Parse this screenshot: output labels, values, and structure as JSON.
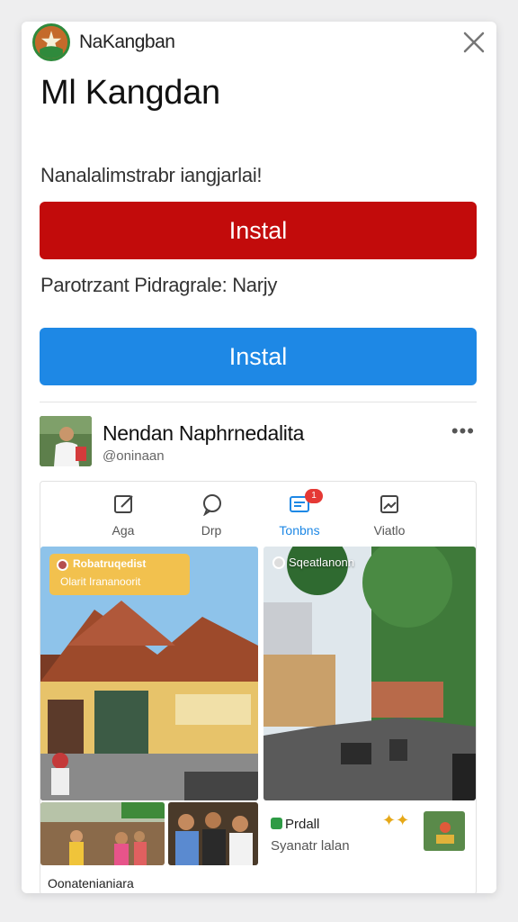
{
  "header": {
    "app_name": "NaKangban"
  },
  "main": {
    "title": "Ml Kangdan",
    "description": "Nanalalimstrabr iangjarlai!",
    "install_primary_label": "Instal",
    "subtitle": "Parotrzant Pidragrale: Narjy",
    "install_secondary_label": "Instal"
  },
  "profile": {
    "name": "Nendan Naphrnedalita",
    "handle": "@oninaan",
    "more_label": "•••"
  },
  "tabs": [
    {
      "label": "Aga",
      "icon": "edit-icon"
    },
    {
      "label": "Drp",
      "icon": "chat-icon"
    },
    {
      "label": "Tonbns",
      "icon": "message-icon",
      "badge": "1"
    },
    {
      "label": "Viatlo",
      "icon": "image-icon"
    }
  ],
  "feed": {
    "photo1_title": "Robatruqedist",
    "photo1_subtitle": "Olarit Irananoorit",
    "photo2_tag": "Sqeatlanonn",
    "promo_title": "Prdall",
    "promo_subtitle": "Syanatr lalan",
    "caption": "Oonatenianiara"
  },
  "colors": {
    "install_primary": "#c20b0b",
    "install_secondary": "#1e88e5",
    "active_tab": "#1e88e5",
    "badge": "#e53935",
    "overlay_label": "#f2c14e"
  }
}
